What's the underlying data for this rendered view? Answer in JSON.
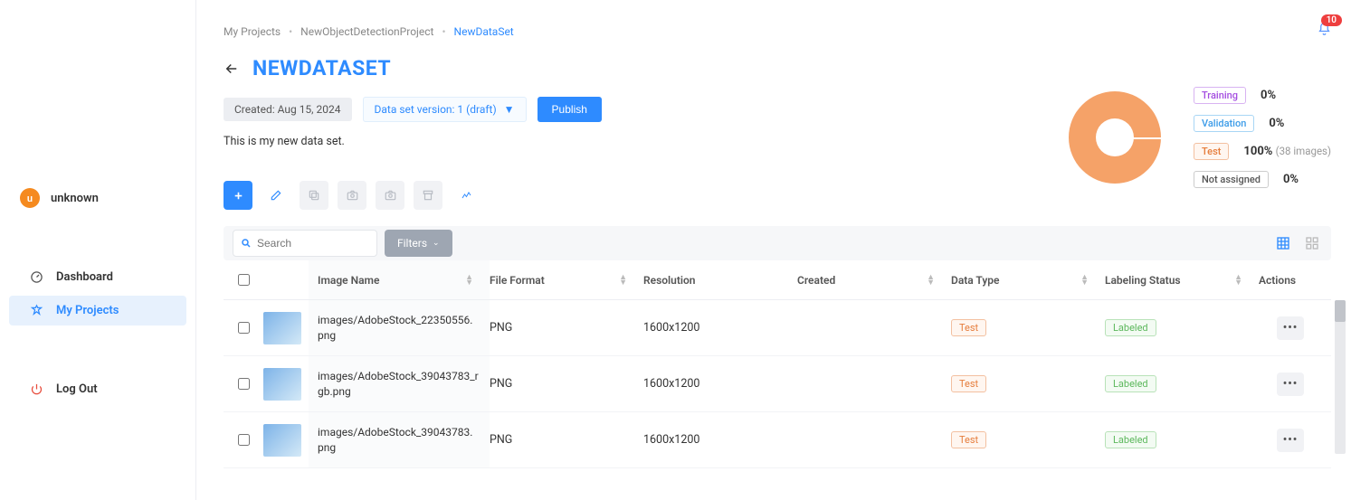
{
  "user": {
    "initial": "u",
    "name": "unknown"
  },
  "nav": {
    "dashboard": "Dashboard",
    "myprojects": "My Projects",
    "logout": "Log Out"
  },
  "notifications": {
    "count": "10"
  },
  "breadcrumbs": {
    "root": "My Projects",
    "project": "NewObjectDetectionProject",
    "dataset": "NewDataSet"
  },
  "page": {
    "title": "NEWDATASET",
    "created": "Created: Aug 15, 2024",
    "version": "Data set version: 1 (draft)",
    "publish": "Publish",
    "description": "This is my new data set."
  },
  "split": {
    "training": {
      "label": "Training",
      "pct": "0%"
    },
    "validation": {
      "label": "Validation",
      "pct": "0%"
    },
    "test": {
      "label": "Test",
      "pct": "100%",
      "sub": "(38 images)"
    },
    "na": {
      "label": "Not assigned",
      "pct": "0%"
    }
  },
  "searchbar": {
    "placeholder": "Search",
    "filters": "Filters"
  },
  "columns": {
    "image_name": "Image Name",
    "file_format": "File Format",
    "resolution": "Resolution",
    "created": "Created",
    "data_type": "Data Type",
    "labeling_status": "Labeling Status",
    "actions": "Actions"
  },
  "rows": [
    {
      "name": "images/AdobeStock_22350556.png",
      "format": "PNG",
      "resolution": "1600x1200",
      "created": "",
      "data_type": "Test",
      "status": "Labeled"
    },
    {
      "name": "images/AdobeStock_39043783_rgb.png",
      "format": "PNG",
      "resolution": "1600x1200",
      "created": "",
      "data_type": "Test",
      "status": "Labeled"
    },
    {
      "name": "images/AdobeStock_39043783.png",
      "format": "PNG",
      "resolution": "1600x1200",
      "created": "",
      "data_type": "Test",
      "status": "Labeled"
    }
  ],
  "chart_data": {
    "type": "pie",
    "title": "Dataset split",
    "series": [
      {
        "name": "Training",
        "value": 0
      },
      {
        "name": "Validation",
        "value": 0
      },
      {
        "name": "Test",
        "value": 100
      },
      {
        "name": "Not assigned",
        "value": 0
      }
    ],
    "total_images": 38
  }
}
